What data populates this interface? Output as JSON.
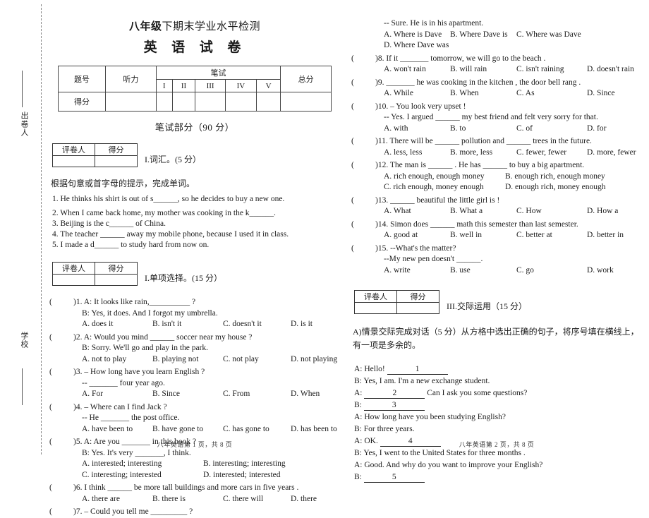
{
  "margin": {
    "writer_label": "出卷人",
    "school_label": "学校"
  },
  "header": {
    "title_line1": "八年级下期末学业水平检测",
    "title_line1_bold": "八年级",
    "title_line1_rest": "下期末学业水平检测",
    "title_line2": "英 语 试 卷",
    "written_part": "笔试部分（90 分）"
  },
  "score_table": {
    "row_label_1": "题号",
    "row_label_2": "得分",
    "listening": "听力",
    "written": "笔试",
    "total": "总分",
    "written_cols": [
      "I",
      "II",
      "III",
      "IV",
      "V"
    ]
  },
  "marker_box": {
    "marker_label": "评卷人",
    "score_label": "得分"
  },
  "section1": {
    "title": "I.词汇。(5 分）",
    "prompt": "根据句意或首字母的提示，完成单词。",
    "items": [
      "1. He thinks his shirt is out of s______, so he decides to buy a new one.",
      "2. When I came back home, my mother was cooking in the k______.",
      "3. Beijing is the c______ of China.",
      "4. The teacher ______ away my mobile phone, because I used it in class.",
      "5. I made a d______ to study hard from now on."
    ]
  },
  "section2": {
    "title": "I.单项选择。(15 分）",
    "questions": [
      {
        "num": ")1.",
        "stem": "A: It looks like rain,__________ ?",
        "sub": "B: Yes, it does. And I forgot my umbrella.",
        "options": [
          "A. does it",
          "B. isn't it",
          "C. doesn't it",
          "D. is it"
        ]
      },
      {
        "num": ")2.",
        "stem": "A: Would you mind ______ soccer near my house ?",
        "sub": "B: Sorry. We'll go and play in the park.",
        "options": [
          "A. not to play",
          "B. playing not",
          "C. not play",
          "D. not playing"
        ]
      },
      {
        "num": ")3.",
        "stem": "– How long have you learn English ?",
        "sub": "-- _______ four year ago.",
        "options": [
          "A. For",
          "B. Since",
          "C. From",
          "D. When"
        ]
      },
      {
        "num": ")4.",
        "stem": "– Where can I find Jack ?",
        "sub": "-- He _______ the post office.",
        "options": [
          "A. have been to",
          "B. have gone to",
          "C. has gone to",
          "D. has been to"
        ]
      },
      {
        "num": ")5.",
        "stem": "A: Are you _______ in this book ?",
        "sub": "B: Yes. It's very _______, I think.",
        "options": [
          "A. interested; interesting",
          "B. interesting; interesting",
          "C. interesting; interested",
          "D. interested; interested"
        ]
      },
      {
        "num": ")6.",
        "stem": "I think ______ be more tall buildings and more cars in five years .",
        "sub": "",
        "options": [
          "A. there are",
          "B. there is",
          "C. there will",
          "D. there"
        ]
      },
      {
        "num": ")7.",
        "stem": "– Could you tell me _________ ?",
        "sub": "",
        "options": []
      }
    ],
    "questions_right": [
      {
        "num": "",
        "stem": "",
        "sub": "-- Sure. He is in his apartment.",
        "options": [
          "A. Where is Dave",
          "B. Where Dave is",
          "C. Where was Dave",
          "D. Where Dave was"
        ]
      },
      {
        "num": ")8.",
        "stem": "If it _______ tomorrow, we will go to the beach .",
        "sub": "",
        "options": [
          "A. won't rain",
          "B. will rain",
          "C. isn't raining",
          "D. doesn't rain"
        ]
      },
      {
        "num": ")9.",
        "stem": "_______ he was cooking in the kitchen , the door bell rang .",
        "sub": "",
        "options": [
          "A. While",
          "B. When",
          "C. As",
          "D. Since"
        ]
      },
      {
        "num": ")10.",
        "stem": "– You look very upset !",
        "sub": "-- Yes. I argued ______ my best friend and felt very sorry for that.",
        "options": [
          "A. with",
          "B. to",
          "C. of",
          "D. for"
        ]
      },
      {
        "num": ")11.",
        "stem": "There will be ______ pollution and ______ trees in the future.",
        "sub": "",
        "options": [
          "A. less, less",
          "B. more, less",
          "C. fewer, fewer",
          "D. more, fewer"
        ]
      },
      {
        "num": ")12.",
        "stem": "The man is ______ . He has ______ to buy a big apartment.",
        "sub": "",
        "options": [
          "A. rich enough, enough money",
          "B. enough rich, enough money",
          "C. rich enough, money enough",
          "D. enough rich, money enough"
        ]
      },
      {
        "num": ")13.",
        "stem": "______ beautiful the little girl is !",
        "sub": "",
        "options": [
          "A. What",
          "B. What a",
          "C. How",
          "D. How a"
        ]
      },
      {
        "num": ")14.",
        "stem": "Simon does ______ math this semester than last semester.",
        "sub": "",
        "options": [
          "A. good at",
          "B. well in",
          "C. better at",
          "D. better in"
        ]
      },
      {
        "num": ")15.",
        "stem": "--What's the matter?",
        "sub": "--My new pen doesn't ______.",
        "options": [
          "A. write",
          "B. use",
          "C. go",
          "D. work"
        ]
      }
    ]
  },
  "section3": {
    "title": "III.交际运用（15 分）",
    "prompt": "A)情景交际完成对话（5 分）从方格中选出正确的句子，将序号填在横线上，有一项是多余的。",
    "dialogue": [
      {
        "speaker": "A: Hello!",
        "blank": "1",
        "tail": ""
      },
      {
        "speaker": "B: Yes, I am. I'm a new exchange student.",
        "blank": "",
        "tail": ""
      },
      {
        "speaker": "A:",
        "blank": "2",
        "tail": "Can I ask you some questions?"
      },
      {
        "speaker": "B:",
        "blank": "3",
        "tail": ""
      },
      {
        "speaker": "A: How long have you been studying English?",
        "blank": "",
        "tail": ""
      },
      {
        "speaker": "B: For three years.",
        "blank": "",
        "tail": ""
      },
      {
        "speaker": "A: OK.",
        "blank": "4",
        "tail": ""
      },
      {
        "speaker": "B: Yes, I went to the United States for three months .",
        "blank": "",
        "tail": ""
      },
      {
        "speaker": "A: Good. And why do you want to improve your English?",
        "blank": "",
        "tail": ""
      },
      {
        "speaker": "B:",
        "blank": "5",
        "tail": ""
      }
    ]
  },
  "footers": {
    "left": "八年英语第 1 页，共 8 页",
    "right": "八年英语第 2 页，共 8 页"
  }
}
